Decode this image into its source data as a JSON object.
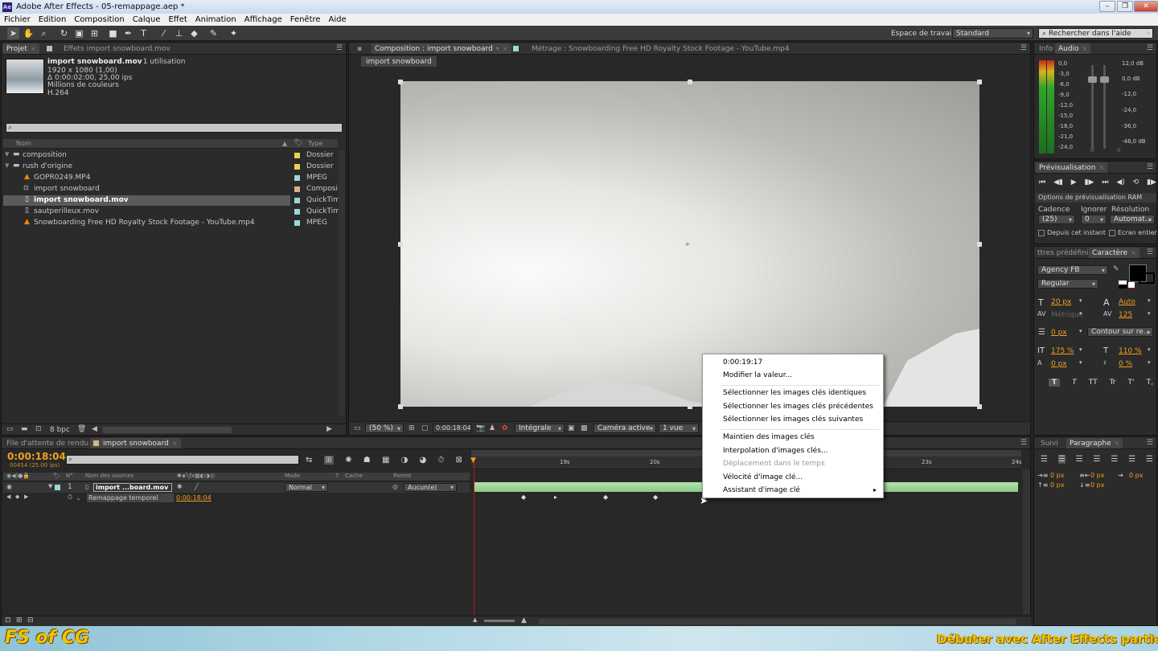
{
  "window": {
    "title": "Adobe After Effects - 05-remappage.aep *",
    "app_badge": "Ae"
  },
  "menu": [
    "Fichier",
    "Edition",
    "Composition",
    "Calque",
    "Effet",
    "Animation",
    "Affichage",
    "Fenêtre",
    "Aide"
  ],
  "toolbar": {
    "workspace_label": "Espace de travail :",
    "workspace_value": "Standard",
    "help_placeholder": "Rechercher dans l'aide"
  },
  "project": {
    "tabs": [
      "Projet",
      "Effets import snowboard.mov"
    ],
    "preview_name": "import snowboard.mov",
    "preview_usage": ", 1 utilisation",
    "preview_info": [
      "1920 x 1080 (1,00)",
      "Δ 0:00:02:00, 25,00 ips",
      "Millions de couleurs",
      "H.264"
    ],
    "col_name": "Nom",
    "col_type": "Type",
    "items": [
      {
        "name": "composition",
        "type": "Dossier",
        "color": "#e8d44a"
      },
      {
        "name": "rush d'origine",
        "type": "Dossier",
        "color": "#e8d44a"
      },
      {
        "name": "GOPR0249.MP4",
        "type": "MPEG",
        "color": "#9cd8d8"
      },
      {
        "name": "import snowboard",
        "type": "Composi",
        "color": "#d4b48c"
      },
      {
        "name": "import snowboard.mov",
        "type": "QuickTim",
        "color": "#9cd8d8"
      },
      {
        "name": "sautperilleux.mov",
        "type": "QuickTim",
        "color": "#9cd8d8"
      },
      {
        "name": "Snowboarding Free HD Royalty Stock Footage - YouTube.mp4",
        "type": "MPEG",
        "color": "#9cd8d8"
      }
    ],
    "bpc": "8 bpc"
  },
  "viewer": {
    "tabs": [
      "Composition : import snowboard",
      "Métrage : Snowboarding Free HD Royalty Stock Footage - YouTube.mp4"
    ],
    "breadcrumb": "import snowboard",
    "zoom": "(50 %)",
    "timecode": "0:00:18:04",
    "resolution": "Intégrale",
    "camera": "Caméra active",
    "views": "1 vue"
  },
  "info_audio": {
    "tabs": [
      "Info",
      "Audio"
    ],
    "db_left": [
      "0,0",
      "-3,0",
      "-6,0",
      "-9,0",
      "-12,0",
      "-15,0",
      "-18,0",
      "-21,0",
      "-24,0"
    ],
    "db_right": [
      "12,0 dB",
      "0,0 dB",
      "-12,0",
      "-24,0",
      "-36,0",
      "-48,0 dB"
    ],
    "slider_zero": [
      "0",
      "0"
    ]
  },
  "preview": {
    "tab": "Prévisualisation",
    "ram_options": "Options de prévisualisation RAM",
    "cadence_label": "Cadence",
    "ignore_label": "Ignorer",
    "resolution_label": "Résolution",
    "cadence_value": "(25)",
    "ignore_value": "0",
    "resolution_value": "Automat...",
    "from_current": "Depuis cet instant",
    "fullscreen": "Ecran entier"
  },
  "character": {
    "tabs": [
      "ttres prédéfinis",
      "Caractère"
    ],
    "font": "Agency FB",
    "style": "Regular",
    "size": "20 px",
    "leading": "Auto",
    "kerning": "Métrique",
    "tracking": "125",
    "stroke_width": "0 px",
    "stroke_type": "Contour sur re...",
    "vscale": "175 %",
    "hscale": "110 %",
    "baseline": "0 px",
    "tsume": "0 %",
    "styles": [
      "T",
      "T",
      "TT",
      "Tr",
      "T'",
      "T,"
    ]
  },
  "paragraph": {
    "tabs": [
      "Suivi",
      "Paragraphe"
    ],
    "indents": [
      "0 px",
      "0 px",
      "0 px",
      "0 px",
      "0 px"
    ]
  },
  "timeline": {
    "tabs": [
      "File d'attente de rendu",
      "import snowboard"
    ],
    "timecode": "0:00:18:04",
    "frames": "00454 (25.00 ips)",
    "headers": {
      "num": "N°",
      "source": "Nom des sources",
      "mode": "Mode",
      "t": "T",
      "cache": "Cache",
      "parent": "Parent"
    },
    "layer": {
      "num": "1",
      "name": "import ...board.mov",
      "mode": "Normal",
      "parent": "Aucun(e)"
    },
    "property": {
      "name": "Remappage temporel",
      "value": "0:00:18:04"
    },
    "ruler": [
      "19s",
      "20s",
      "23s",
      "24s"
    ],
    "keyframes": [
      0.09,
      0.15,
      0.24,
      0.33,
      0.42
    ]
  },
  "context_menu": {
    "items": [
      {
        "label": "0:00:19:17",
        "disabled": false
      },
      {
        "label": "Modifier la valeur...",
        "disabled": false
      },
      {
        "label": "Sélectionner les images clés identiques",
        "disabled": false
      },
      {
        "label": "Sélectionner les images clés précédentes",
        "disabled": false
      },
      {
        "label": "Sélectionner les images clés suivantes",
        "disabled": false
      },
      {
        "label": "Maintien des images clés",
        "disabled": false
      },
      {
        "label": "Interpolation d'images clés...",
        "disabled": false
      },
      {
        "label": "Déplacement dans le temps",
        "disabled": true
      },
      {
        "label": "Vélocité d'image clé...",
        "disabled": false
      },
      {
        "label": "Assistant d'image clé",
        "disabled": false,
        "submenu": true
      }
    ]
  },
  "banner": {
    "logo": "FS of CG",
    "caption": "Débuter avec After Effects partie VI"
  },
  "colors": {
    "accent_orange": "#f0a020",
    "playhead_red": "#d01010",
    "layer_bar_green": "#9fd29a"
  }
}
